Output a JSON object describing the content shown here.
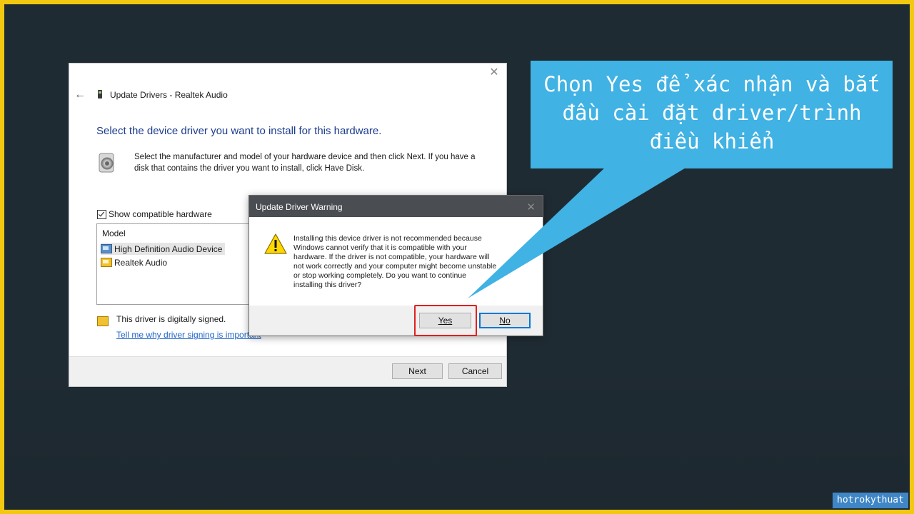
{
  "wizard": {
    "title": "Update Drivers - Realtek Audio",
    "heading": "Select the device driver you want to install for this hardware.",
    "description": "Select the manufacturer and model of your hardware device and then click Next. If you have a disk that contains the driver you want to install, click Have Disk.",
    "show_compatible_label": "Show compatible hardware",
    "show_compatible_checked": true,
    "model_header": "Model",
    "models": [
      {
        "label": "High Definition Audio Device",
        "selected": true,
        "icon": "monitor-icon"
      },
      {
        "label": "Realtek Audio",
        "selected": false,
        "icon": "driver-icon"
      }
    ],
    "signed_text": "This driver is digitally signed.",
    "signing_link": "Tell me why driver signing is important",
    "next_label": "Next",
    "cancel_label": "Cancel"
  },
  "warning": {
    "title": "Update Driver Warning",
    "message": "Installing this device driver is not recommended because\nWindows cannot verify that it is compatible with your\nhardware.  If the driver is not compatible, your hardware will\nnot work correctly and your computer might become unstable\nor stop working completely.  Do you want to continue\ninstalling this driver?",
    "yes_label": "Yes",
    "no_label": "No"
  },
  "callout": {
    "text": "Chọn Yes để xác nhận và bắt đầu cài đặt driver/trình điều khiển"
  },
  "watermark": "hotrokythuat",
  "colors": {
    "background": "#1f2b33",
    "border": "#f2c811",
    "callout": "#40b2e4",
    "highlight": "#e0201f",
    "heading": "#1c3c8c"
  }
}
